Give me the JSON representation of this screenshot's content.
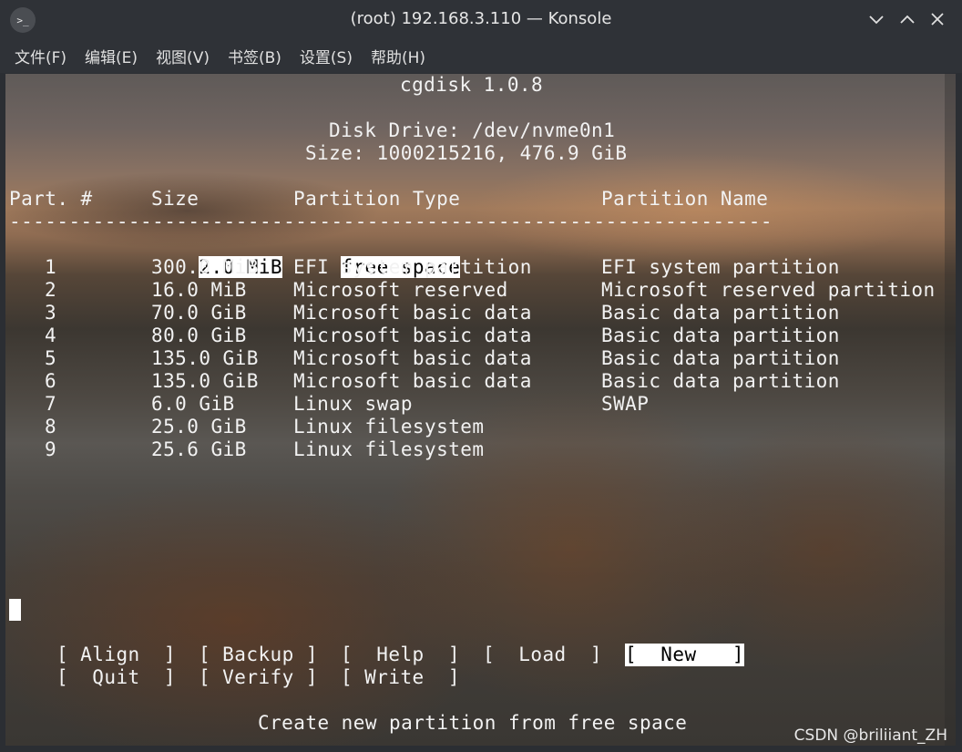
{
  "window": {
    "title": "(root) 192.168.3.110 — Konsole",
    "app_icon_glyph": ">_"
  },
  "menu": [
    "文件(F)",
    "编辑(E)",
    "视图(V)",
    "书签(B)",
    "设置(S)",
    "帮助(H)"
  ],
  "terminal": {
    "program_title": "cgdisk 1.0.8",
    "disk_drive": "Disk Drive: /dev/nvme0n1",
    "disk_size": "Size: 1000215216, 476.9 GiB",
    "headers": {
      "part": "Part. #",
      "size": "Size",
      "type": "Partition Type",
      "name": "Partition Name"
    },
    "separator": "----------------------------------------------------------------",
    "free_space": {
      "size": "2.0 MiB",
      "type": "free space"
    },
    "partitions": [
      {
        "num": "1",
        "size": "300.0 MiB",
        "type": "EFI system partition",
        "name": "EFI system partition"
      },
      {
        "num": "2",
        "size": "16.0 MiB",
        "type": "Microsoft reserved",
        "name": "Microsoft reserved partition"
      },
      {
        "num": "3",
        "size": "70.0 GiB",
        "type": "Microsoft basic data",
        "name": "Basic data partition"
      },
      {
        "num": "4",
        "size": "80.0 GiB",
        "type": "Microsoft basic data",
        "name": "Basic data partition"
      },
      {
        "num": "5",
        "size": "135.0 GiB",
        "type": "Microsoft basic data",
        "name": "Basic data partition"
      },
      {
        "num": "6",
        "size": "135.0 GiB",
        "type": "Microsoft basic data",
        "name": "Basic data partition"
      },
      {
        "num": "7",
        "size": "6.0 GiB",
        "type": "Linux swap",
        "name": "SWAP"
      },
      {
        "num": "8",
        "size": "25.0 GiB",
        "type": "Linux filesystem",
        "name": ""
      },
      {
        "num": "9",
        "size": "25.6 GiB",
        "type": "Linux filesystem",
        "name": ""
      }
    ],
    "buttons": {
      "align": "[ Align  ]",
      "backup": "[ Backup ]",
      "help": "[  Help  ]",
      "load": "[  Load  ]",
      "new": "[  New   ]",
      "quit": "[  Quit  ]",
      "verify": "[ Verify ]",
      "write": "[ Write  ]"
    },
    "status": "Create new partition from free space"
  },
  "watermark": "CSDN @briliiant_ZH"
}
